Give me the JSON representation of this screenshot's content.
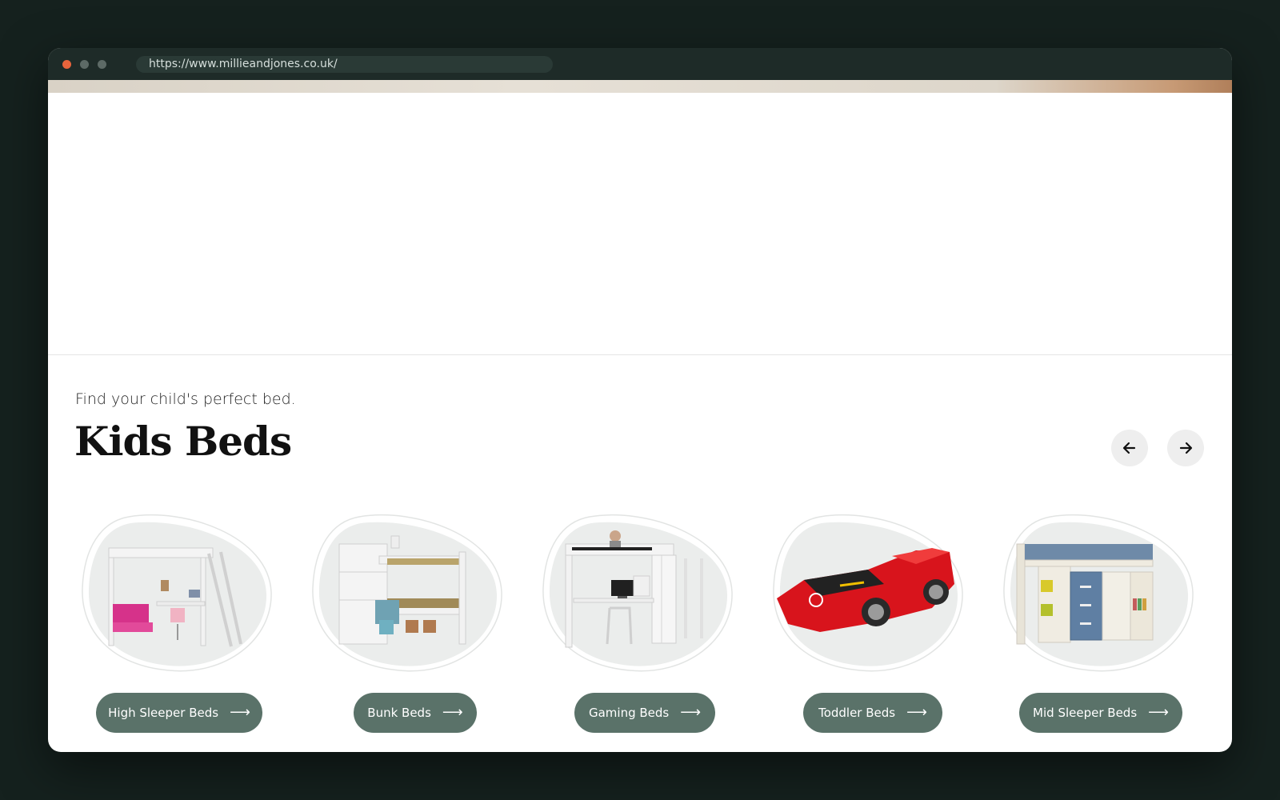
{
  "browser": {
    "url": "https://www.millieandjones.co.uk/"
  },
  "section": {
    "subtitle": "Find your child's perfect bed.",
    "heading": "Kids Beds",
    "prev_icon": "arrow-left-icon",
    "next_icon": "arrow-right-icon"
  },
  "categories": [
    {
      "label": "High Sleeper Beds",
      "arrow": "⟶",
      "image": "white-high-sleeper-bed-with-pink-sofa-and-desk"
    },
    {
      "label": "Bunk Beds",
      "arrow": "⟶",
      "image": "white-bunk-bed-with-storage-baskets"
    },
    {
      "label": "Gaming Beds",
      "arrow": "⟶",
      "image": "white-high-sleeper-with-desk-and-monitor"
    },
    {
      "label": "Toddler Beds",
      "arrow": "⟶",
      "image": "red-racing-car-bed"
    },
    {
      "label": "Mid Sleeper Beds",
      "arrow": "⟶",
      "image": "blue-mid-sleeper-with-drawers-and-shelves"
    }
  ],
  "colors": {
    "button_bg": "#5a7269",
    "page_bg": "#15211e",
    "blob_fill": "#ebedec"
  }
}
